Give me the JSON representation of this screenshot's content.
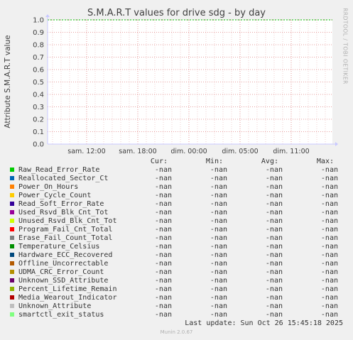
{
  "title": "S.M.A.R.T values for drive sdg - by day",
  "side_label": "RRDTOOL / TOBI OETIKER",
  "colors": {
    "grid_major": "#e08080",
    "grid_minor": "#e9b3b3",
    "baseline": "#00c000"
  },
  "chart_data": {
    "type": "line",
    "ylabel": "Attribute S.M.A.R.T value",
    "ylim": [
      0,
      1
    ],
    "y_ticks": [
      "0.0",
      "0.1",
      "0.2",
      "0.3",
      "0.4",
      "0.5",
      "0.6",
      "0.7",
      "0.8",
      "0.9",
      "1.0"
    ],
    "x_ticks": [
      "sam. 12:00",
      "sam. 18:00",
      "dim. 00:00",
      "dim. 05:00",
      "dim. 11:00"
    ],
    "series_values": "-nan"
  },
  "legend": {
    "headers": {
      "cur": "Cur:",
      "min": "Min:",
      "avg": "Avg:",
      "max": "Max:"
    },
    "items": [
      {
        "name": "Raw_Read_Error_Rate",
        "color": "#00cc00",
        "cur": "-nan",
        "min": "-nan",
        "avg": "-nan",
        "max": "-nan"
      },
      {
        "name": "Reallocated_Sector_Ct",
        "color": "#0066b3",
        "cur": "-nan",
        "min": "-nan",
        "avg": "-nan",
        "max": "-nan"
      },
      {
        "name": "Power_On_Hours",
        "color": "#ff8000",
        "cur": "-nan",
        "min": "-nan",
        "avg": "-nan",
        "max": "-nan"
      },
      {
        "name": "Power_Cycle_Count",
        "color": "#ffcc00",
        "cur": "-nan",
        "min": "-nan",
        "avg": "-nan",
        "max": "-nan"
      },
      {
        "name": "Read_Soft_Error_Rate",
        "color": "#330099",
        "cur": "-nan",
        "min": "-nan",
        "avg": "-nan",
        "max": "-nan"
      },
      {
        "name": "Used_Rsvd_Blk_Cnt_Tot",
        "color": "#990099",
        "cur": "-nan",
        "min": "-nan",
        "avg": "-nan",
        "max": "-nan"
      },
      {
        "name": "Unused_Rsvd_Blk_Cnt_Tot",
        "color": "#ccff00",
        "cur": "-nan",
        "min": "-nan",
        "avg": "-nan",
        "max": "-nan"
      },
      {
        "name": "Program_Fail_Cnt_Total",
        "color": "#ff0000",
        "cur": "-nan",
        "min": "-nan",
        "avg": "-nan",
        "max": "-nan"
      },
      {
        "name": "Erase_Fail_Count_Total",
        "color": "#808080",
        "cur": "-nan",
        "min": "-nan",
        "avg": "-nan",
        "max": "-nan"
      },
      {
        "name": "Temperature_Celsius",
        "color": "#008f00",
        "cur": "-nan",
        "min": "-nan",
        "avg": "-nan",
        "max": "-nan"
      },
      {
        "name": "Hardware_ECC_Recovered",
        "color": "#00487d",
        "cur": "-nan",
        "min": "-nan",
        "avg": "-nan",
        "max": "-nan"
      },
      {
        "name": "Offline_Uncorrectable",
        "color": "#b35a00",
        "cur": "-nan",
        "min": "-nan",
        "avg": "-nan",
        "max": "-nan"
      },
      {
        "name": "UDMA_CRC_Error_Count",
        "color": "#b38f00",
        "cur": "-nan",
        "min": "-nan",
        "avg": "-nan",
        "max": "-nan"
      },
      {
        "name": "Unknown_SSD_Attribute",
        "color": "#6b006b",
        "cur": "-nan",
        "min": "-nan",
        "avg": "-nan",
        "max": "-nan"
      },
      {
        "name": "Percent_Lifetime_Remain",
        "color": "#8fb300",
        "cur": "-nan",
        "min": "-nan",
        "avg": "-nan",
        "max": "-nan"
      },
      {
        "name": "Media_Wearout_Indicator",
        "color": "#b30000",
        "cur": "-nan",
        "min": "-nan",
        "avg": "-nan",
        "max": "-nan"
      },
      {
        "name": "Unknown_Attribute",
        "color": "#bebebe",
        "cur": "-nan",
        "min": "-nan",
        "avg": "-nan",
        "max": "-nan"
      },
      {
        "name": "smartctl_exit_status",
        "color": "#80ff80",
        "cur": "-nan",
        "min": "-nan",
        "avg": "-nan",
        "max": "-nan"
      }
    ]
  },
  "last_update": "Last update: Sun Oct 26 15:45:18 2025",
  "footer": "Munin 2.0.67"
}
